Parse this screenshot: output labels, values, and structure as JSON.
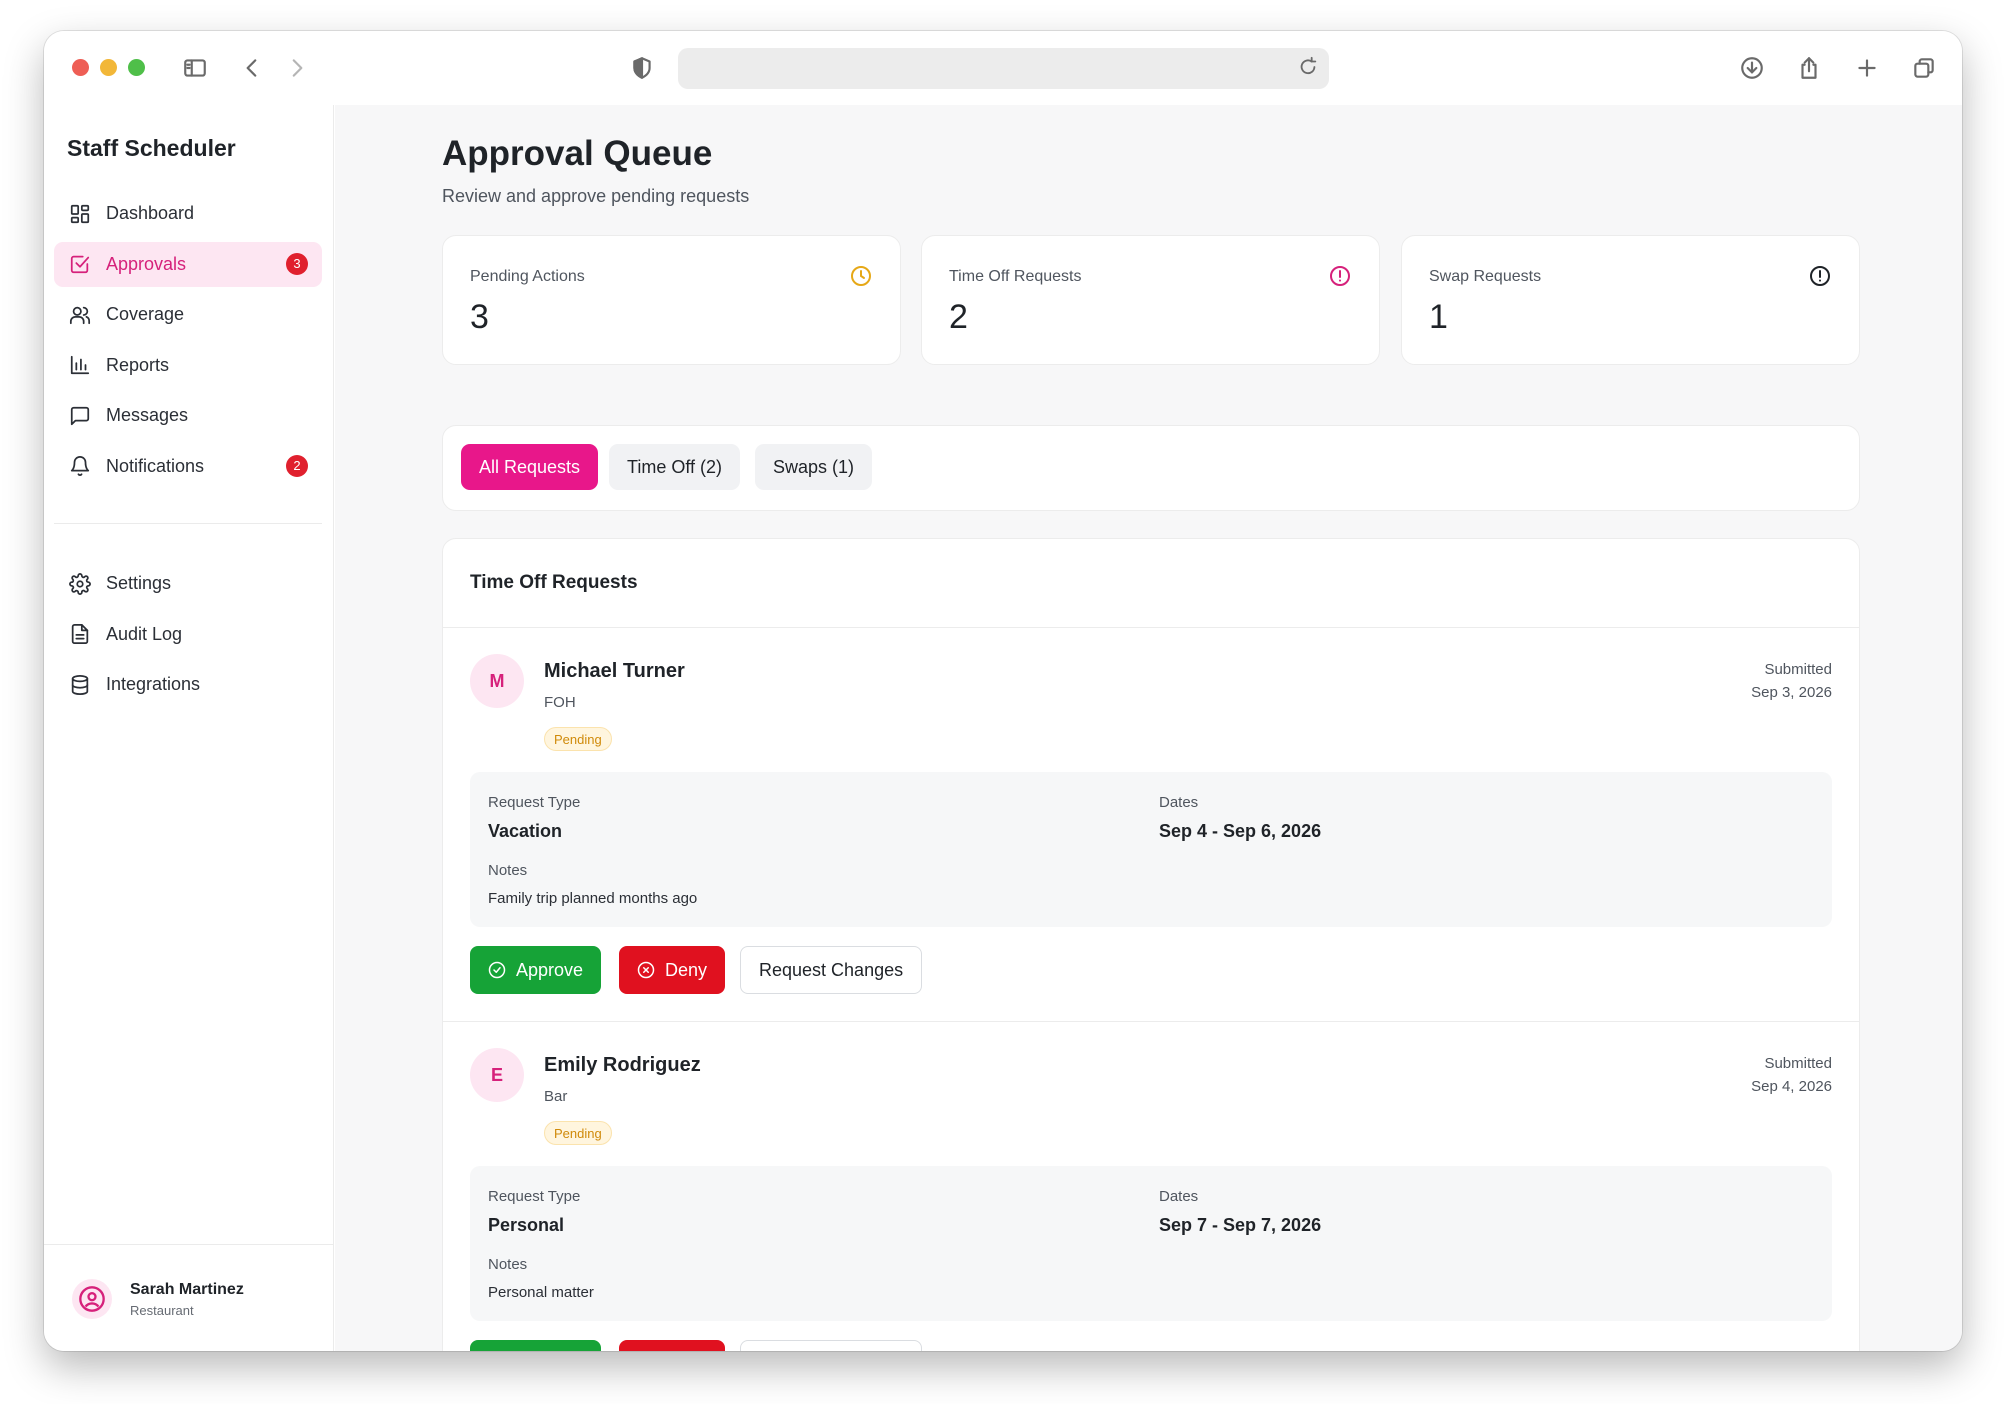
{
  "sidebar": {
    "title": "Staff Scheduler",
    "items": [
      {
        "label": "Dashboard",
        "icon": "grid-icon"
      },
      {
        "label": "Approvals",
        "icon": "check-square-icon",
        "badge": "3",
        "active": true
      },
      {
        "label": "Coverage",
        "icon": "users-icon"
      },
      {
        "label": "Reports",
        "icon": "bar-chart-icon"
      },
      {
        "label": "Messages",
        "icon": "message-icon"
      },
      {
        "label": "Notifications",
        "icon": "bell-icon",
        "badge": "2"
      }
    ],
    "secondary_items": [
      {
        "label": "Settings",
        "icon": "gear-icon"
      },
      {
        "label": "Audit Log",
        "icon": "file-text-icon"
      },
      {
        "label": "Integrations",
        "icon": "database-icon"
      }
    ],
    "user": {
      "name": "Sarah Martinez",
      "org": "Restaurant"
    }
  },
  "header": {
    "title": "Approval Queue",
    "subtitle": "Review and approve pending requests"
  },
  "stats": [
    {
      "label": "Pending Actions",
      "value": "3",
      "icon": "clock-icon",
      "color": "#e6a817"
    },
    {
      "label": "Time Off Requests",
      "value": "2",
      "icon": "alert-circle-icon",
      "color": "#d6217b"
    },
    {
      "label": "Swap Requests",
      "value": "1",
      "icon": "alert-circle-icon",
      "color": "#1f2328"
    }
  ],
  "tabs": [
    {
      "label": "All Requests",
      "active": true
    },
    {
      "label": "Time Off (2)"
    },
    {
      "label": "Swaps (1)"
    }
  ],
  "section": {
    "title": "Time Off Requests"
  },
  "labels": {
    "submitted": "Submitted",
    "request_type": "Request Type",
    "dates": "Dates",
    "notes": "Notes",
    "approve": "Approve",
    "deny": "Deny",
    "request_changes": "Request Changes"
  },
  "requests": [
    {
      "initial": "M",
      "name": "Michael Turner",
      "role": "FOH",
      "status": "Pending",
      "submitted_date": "Sep 3, 2026",
      "type": "Vacation",
      "dates": "Sep 4 - Sep 6, 2026",
      "notes": "Family trip planned months ago"
    },
    {
      "initial": "E",
      "name": "Emily Rodriguez",
      "role": "Bar",
      "status": "Pending",
      "submitted_date": "Sep 4, 2026",
      "type": "Personal",
      "dates": "Sep 7 - Sep 7, 2026",
      "notes": "Personal matter"
    }
  ],
  "colors": {
    "accent": "#e8178a",
    "approve": "#16a337",
    "deny": "#e0111f",
    "badge": "#e0202e"
  }
}
